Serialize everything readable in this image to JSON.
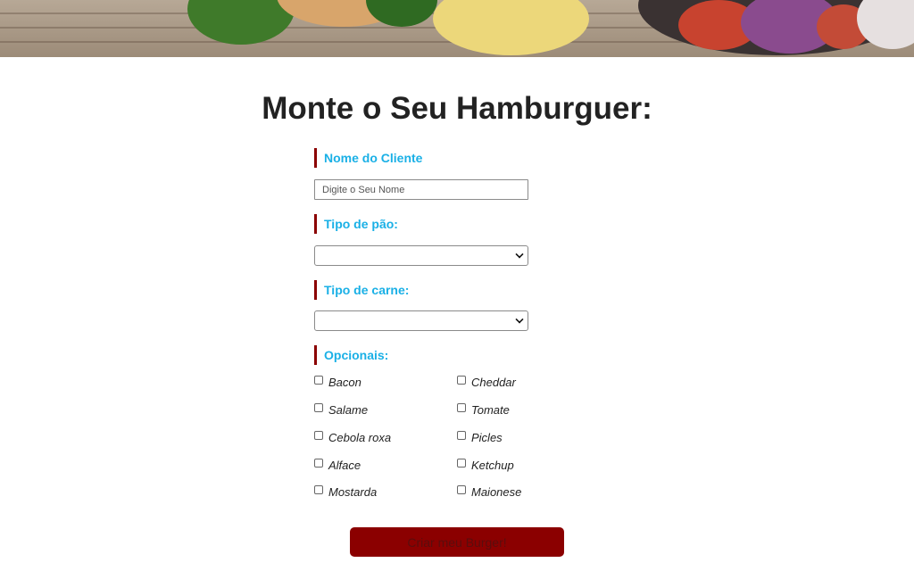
{
  "page": {
    "title": "Monte o Seu Hamburguer:"
  },
  "form": {
    "name_label": "Nome do Cliente",
    "name_placeholder": "Digite o Seu Nome",
    "name_value": "",
    "bread_label": "Tipo de pão:",
    "bread_selected": "",
    "meat_label": "Tipo de carne:",
    "meat_selected": "",
    "extras_label": "Opcionais:",
    "extras": [
      {
        "label": "Bacon",
        "checked": false
      },
      {
        "label": "Cheddar",
        "checked": false
      },
      {
        "label": "Salame",
        "checked": false
      },
      {
        "label": "Tomate",
        "checked": false
      },
      {
        "label": "Cebola roxa",
        "checked": false
      },
      {
        "label": "Picles",
        "checked": false
      },
      {
        "label": "Alface",
        "checked": false
      },
      {
        "label": "Ketchup",
        "checked": false
      },
      {
        "label": "Mostarda",
        "checked": false
      },
      {
        "label": "Maionese",
        "checked": false
      }
    ],
    "submit_label": "Criar meu Burger!"
  },
  "colors": {
    "accent_label": "#1ab0e6",
    "label_bar": "#8b0000",
    "button_bg": "#8b0000"
  }
}
